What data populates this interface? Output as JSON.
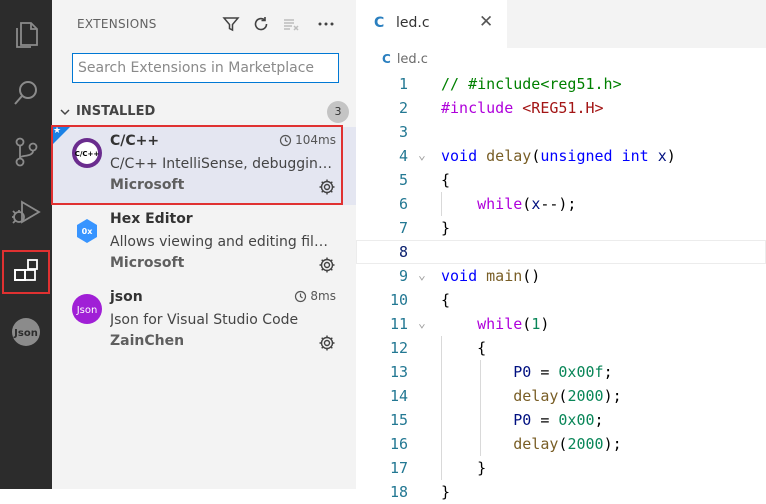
{
  "activity_bar": {
    "items": [
      {
        "name": "explorer-icon",
        "active": false
      },
      {
        "name": "search-icon",
        "active": false
      },
      {
        "name": "source-control-icon",
        "active": false
      },
      {
        "name": "run-debug-icon",
        "active": false
      },
      {
        "name": "extensions-icon",
        "active": true
      },
      {
        "name": "json-extension-icon",
        "active": false
      }
    ],
    "json_label": "Json"
  },
  "sidebar": {
    "title": "EXTENSIONS",
    "actions": [
      "filter-icon",
      "refresh-icon",
      "clear-icon",
      "more-icon"
    ],
    "search": {
      "placeholder": "Search Extensions in Marketplace",
      "value": ""
    },
    "section": {
      "title": "INSTALLED",
      "count": "3"
    },
    "extensions": [
      {
        "name": "C/C++",
        "icon_label": "C/C++",
        "description": "C/C++ IntelliSense, debugging, and code browsing.",
        "publisher": "Microsoft",
        "time": "104ms",
        "selected": true,
        "starred": true
      },
      {
        "name": "Hex Editor",
        "icon_label": "0x",
        "description": "Allows viewing and editing files in a hex editor",
        "publisher": "Microsoft",
        "time": "",
        "selected": false,
        "starred": false
      },
      {
        "name": "json",
        "icon_label": "Json",
        "description": "Json for Visual Studio Code",
        "publisher": "ZainChen",
        "time": "8ms",
        "selected": false,
        "starred": false
      }
    ]
  },
  "editor": {
    "tab": {
      "icon": "C",
      "label": "led.c"
    },
    "breadcrumb": {
      "icon": "C",
      "label": "led.c"
    },
    "current_line": 8,
    "lines": [
      {
        "n": "1",
        "fold": false,
        "tokens": [
          {
            "t": "// #include<reg51.h>",
            "c": "com"
          }
        ]
      },
      {
        "n": "2",
        "fold": false,
        "tokens": [
          {
            "t": "#include ",
            "c": "pp"
          },
          {
            "t": "<REG51.H>",
            "c": "str"
          }
        ]
      },
      {
        "n": "3",
        "fold": false,
        "tokens": []
      },
      {
        "n": "4",
        "fold": true,
        "tokens": [
          {
            "t": "void",
            "c": "kw"
          },
          {
            "t": " ",
            "c": ""
          },
          {
            "t": "delay",
            "c": "fn"
          },
          {
            "t": "(",
            "c": ""
          },
          {
            "t": "unsigned",
            "c": "kw"
          },
          {
            "t": " ",
            "c": ""
          },
          {
            "t": "int",
            "c": "kw"
          },
          {
            "t": " ",
            "c": ""
          },
          {
            "t": "x",
            "c": "var"
          },
          {
            "t": ")",
            "c": ""
          }
        ]
      },
      {
        "n": "5",
        "fold": false,
        "tokens": [
          {
            "t": "{",
            "c": ""
          }
        ]
      },
      {
        "n": "6",
        "fold": false,
        "tokens": [
          {
            "t": "    ",
            "c": ""
          },
          {
            "t": "while",
            "c": "ctl"
          },
          {
            "t": "(",
            "c": ""
          },
          {
            "t": "x",
            "c": "var"
          },
          {
            "t": "--);",
            "c": ""
          }
        ]
      },
      {
        "n": "7",
        "fold": false,
        "tokens": [
          {
            "t": "}",
            "c": ""
          }
        ]
      },
      {
        "n": "8",
        "fold": false,
        "tokens": []
      },
      {
        "n": "9",
        "fold": true,
        "tokens": [
          {
            "t": "void",
            "c": "kw"
          },
          {
            "t": " ",
            "c": ""
          },
          {
            "t": "main",
            "c": "fn"
          },
          {
            "t": "()",
            "c": ""
          }
        ]
      },
      {
        "n": "10",
        "fold": false,
        "tokens": [
          {
            "t": "{",
            "c": ""
          }
        ]
      },
      {
        "n": "11",
        "fold": true,
        "tokens": [
          {
            "t": "    ",
            "c": ""
          },
          {
            "t": "while",
            "c": "ctl"
          },
          {
            "t": "(",
            "c": ""
          },
          {
            "t": "1",
            "c": "num"
          },
          {
            "t": ")",
            "c": ""
          }
        ]
      },
      {
        "n": "12",
        "fold": false,
        "tokens": [
          {
            "t": "    {",
            "c": ""
          }
        ]
      },
      {
        "n": "13",
        "fold": false,
        "tokens": [
          {
            "t": "        ",
            "c": ""
          },
          {
            "t": "P0",
            "c": "var"
          },
          {
            "t": " = ",
            "c": ""
          },
          {
            "t": "0x00f",
            "c": "num"
          },
          {
            "t": ";",
            "c": ""
          }
        ]
      },
      {
        "n": "14",
        "fold": false,
        "tokens": [
          {
            "t": "        ",
            "c": ""
          },
          {
            "t": "delay",
            "c": "fn"
          },
          {
            "t": "(",
            "c": ""
          },
          {
            "t": "2000",
            "c": "num"
          },
          {
            "t": ");",
            "c": ""
          }
        ]
      },
      {
        "n": "15",
        "fold": false,
        "tokens": [
          {
            "t": "        ",
            "c": ""
          },
          {
            "t": "P0",
            "c": "var"
          },
          {
            "t": " = ",
            "c": ""
          },
          {
            "t": "0x00",
            "c": "num"
          },
          {
            "t": ";",
            "c": ""
          }
        ]
      },
      {
        "n": "16",
        "fold": false,
        "tokens": [
          {
            "t": "        ",
            "c": ""
          },
          {
            "t": "delay",
            "c": "fn"
          },
          {
            "t": "(",
            "c": ""
          },
          {
            "t": "2000",
            "c": "num"
          },
          {
            "t": ");",
            "c": ""
          }
        ]
      },
      {
        "n": "17",
        "fold": false,
        "tokens": [
          {
            "t": "    }",
            "c": ""
          }
        ]
      },
      {
        "n": "18",
        "fold": false,
        "tokens": [
          {
            "t": "}",
            "c": ""
          }
        ]
      }
    ]
  },
  "colors": {
    "accent": "#0078d4",
    "highlight_frame": "#e03131",
    "activity_bg": "#2c2c2c",
    "sidebar_bg": "#f3f3f3"
  }
}
